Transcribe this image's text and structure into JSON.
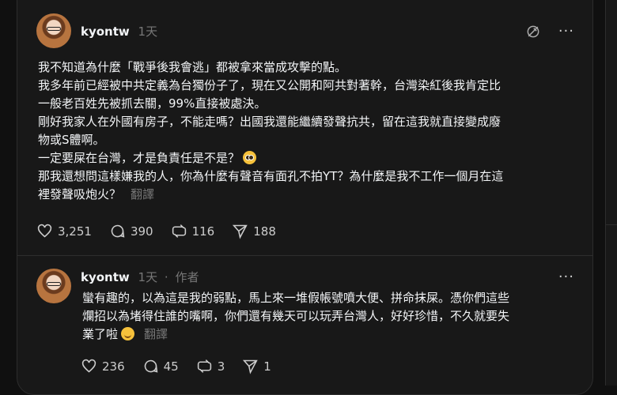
{
  "post": {
    "username": "kyontw",
    "time": "1天",
    "lines": [
      "我不知道為什麼「戰爭後我會逃」都被拿來當成攻擊的點。",
      "我多年前已經被中共定義為台獨份子了，現在又公開和阿共對著幹，台灣染紅後我肯定比",
      "一般老百姓先被抓去關，99%直接被處決。",
      "剛好我家人在外國有房子，不能走嗎？出國我還能繼續發聲抗共，留在這我就直接變成廢",
      "物或S體啊。",
      "一定要屎在台灣，才是負責任是不是？",
      "那我還想問這樣嫌我的人，你為什麼有聲音有面孔不拍YT？為什麼是我不工作一個月在這",
      "裡發聲吸炮火？"
    ],
    "translate": "翻譯",
    "likes": "3,251",
    "comments": "390",
    "reposts": "116",
    "shares": "188"
  },
  "reply": {
    "username": "kyontw",
    "time": "1天",
    "sep": "·",
    "author_tag": "作者",
    "lines": [
      "蠻有趣的，以為這是我的弱點，馬上來一堆假帳號噴大便、拼命抹屎。憑你們這些",
      "爛招以為堵得住誰的嘴啊，你們還有幾天可以玩弄台灣人，好好珍惜，不久就要失",
      "業了啦"
    ],
    "translate": "翻譯",
    "likes": "236",
    "comments": "45",
    "reposts": "3",
    "shares": "1"
  },
  "icons": {
    "more": "more-dots-icon",
    "mute": "mute-icon",
    "like": "heart-icon",
    "comment": "comment-icon",
    "repost": "repost-icon",
    "share": "send-icon"
  },
  "colors": {
    "background": "#101010",
    "card": "#181818",
    "muted": "#777777",
    "text": "#f3f5f7"
  }
}
